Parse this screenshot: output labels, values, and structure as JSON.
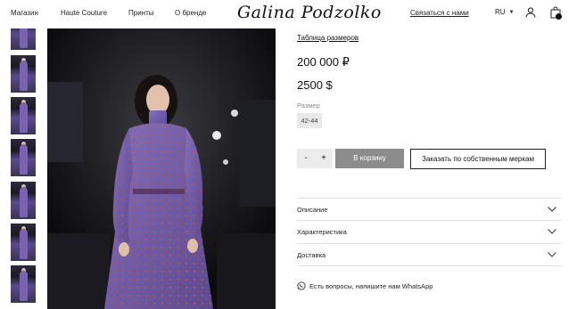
{
  "header": {
    "nav": [
      "Магазин",
      "Haute Couture",
      "Принты",
      "О бренде"
    ],
    "logo": "Galina Podzolko",
    "contact": "Связаться с нами",
    "language": "RU"
  },
  "gallery": {
    "thumbnail_count": 7
  },
  "product": {
    "size_table_link": "Таблица размеров",
    "price_rub": "200 000 ₽",
    "price_usd": "2500 $",
    "size_label": "Размер",
    "size_options": [
      "42-44"
    ],
    "qty_minus": "-",
    "qty_plus": "+",
    "add_to_cart": "В корзину",
    "custom_order": "Заказать по собственным меркам"
  },
  "accordion": [
    {
      "title": "Описание"
    },
    {
      "title": "Характеристика"
    },
    {
      "title": "Доставка"
    }
  ],
  "whatsapp": {
    "text": "Есть вопросы, напишите нам WhatsApp"
  },
  "colors": {
    "dress": "#7560ae",
    "cart_button_bg": "#8c8c8c",
    "size_option_bg": "#e9e9e9"
  }
}
